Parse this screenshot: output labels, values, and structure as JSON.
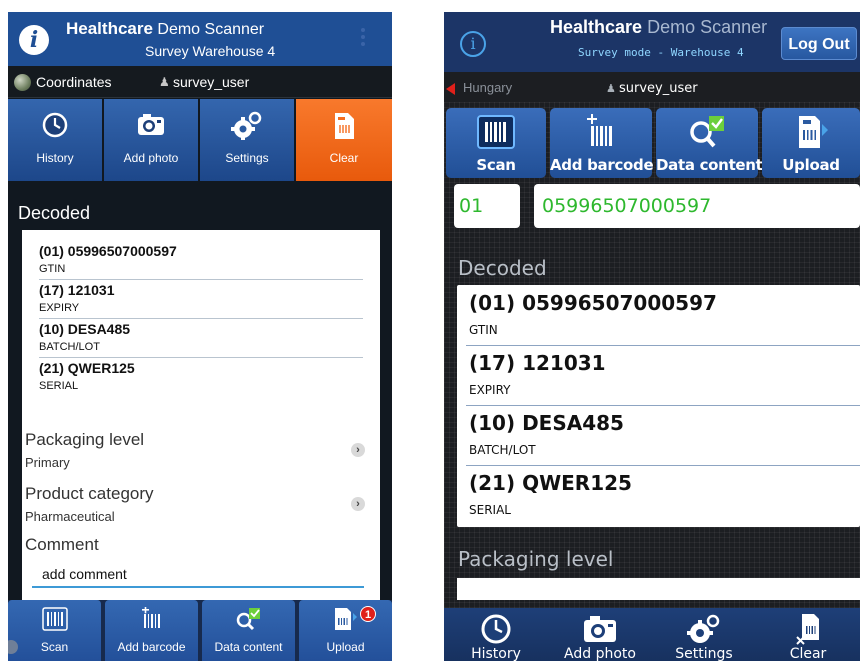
{
  "left": {
    "header": {
      "logo_letter": "i",
      "title_bold": "Healthcare",
      "title_rest": "Demo Scanner",
      "subtitle": "Survey Warehouse 4"
    },
    "info_bar": {
      "location": "Coordinates",
      "user": "survey_user"
    },
    "toolbar": [
      {
        "label": "History",
        "icon": "clock-icon"
      },
      {
        "label": "Add photo",
        "icon": "camera-icon"
      },
      {
        "label": "Settings",
        "icon": "gear-icon"
      },
      {
        "label": "Clear",
        "icon": "clear-document-icon"
      }
    ],
    "decoded_title": "Decoded",
    "decoded": [
      {
        "value": "(01) 05996507000597",
        "key": "GTIN"
      },
      {
        "value": "(17) 121031",
        "key": "EXPIRY"
      },
      {
        "value": "(10) DESA485",
        "key": "BATCH/LOT"
      },
      {
        "value": "(21) QWER125",
        "key": "SERIAL"
      }
    ],
    "packaging": {
      "title": "Packaging level",
      "value": "Primary"
    },
    "category": {
      "title": "Product category",
      "value": "Pharmaceutical"
    },
    "comment": {
      "title": "Comment",
      "value": "add comment"
    },
    "bottom_bar": [
      {
        "label": "Scan",
        "icon": "barcode-icon"
      },
      {
        "label": "Add barcode",
        "icon": "add-barcode-icon"
      },
      {
        "label": "Data content",
        "icon": "magnifier-check-icon"
      },
      {
        "label": "Upload",
        "icon": "upload-icon",
        "badge": "1"
      }
    ]
  },
  "right": {
    "header": {
      "title_bold": "Healthcare",
      "title_rest": "Demo Scanner",
      "subtitle": "Survey mode - Warehouse 4",
      "logout": "Log Out"
    },
    "info_bar": {
      "location": "Hungary",
      "user": "survey_user"
    },
    "toolbar": [
      {
        "label": "Scan",
        "icon": "barcode-icon"
      },
      {
        "label": "Add barcode",
        "icon": "add-barcode-icon"
      },
      {
        "label": "Data content",
        "icon": "magnifier-check-icon"
      },
      {
        "label": "Upload",
        "icon": "upload-icon"
      }
    ],
    "ai_field": "01",
    "code_field": "05996507000597",
    "decoded_title": "Decoded",
    "decoded": [
      {
        "value": "(01) 05996507000597",
        "key": "GTIN"
      },
      {
        "value": "(17) 121031",
        "key": "EXPIRY"
      },
      {
        "value": "(10) DESA485",
        "key": "BATCH/LOT"
      },
      {
        "value": "(21) QWER125",
        "key": "SERIAL"
      }
    ],
    "packaging_title": "Packaging level",
    "bottom_bar": [
      {
        "label": "History",
        "icon": "clock-icon"
      },
      {
        "label": "Add photo",
        "icon": "camera-icon"
      },
      {
        "label": "Settings",
        "icon": "gear-icon"
      },
      {
        "label": "Clear",
        "icon": "clear-document-icon"
      }
    ]
  },
  "colors": {
    "primary_blue": "#1f4f95",
    "clear_orange": "#f46d1f",
    "code_green": "#2eb82e",
    "badge_red": "#e0201a"
  }
}
